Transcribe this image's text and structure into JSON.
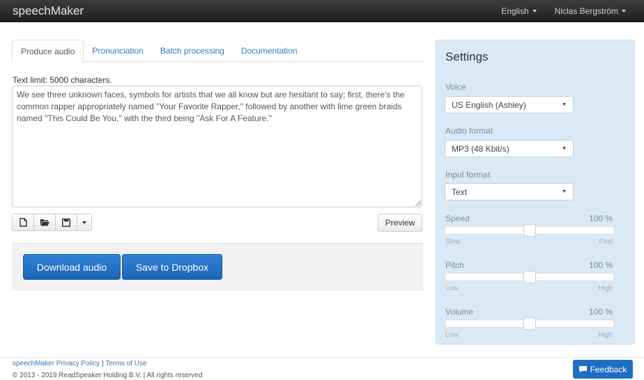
{
  "navbar": {
    "brand": "speechMaker",
    "language": "English",
    "user": "Niclas Bergström"
  },
  "tabs": [
    {
      "label": "Produce audio",
      "active": true
    },
    {
      "label": "Pronunciation",
      "active": false
    },
    {
      "label": "Batch processing",
      "active": false
    },
    {
      "label": "Documentation",
      "active": false
    }
  ],
  "editor": {
    "limit_text": "Text limit: 5000 characters.",
    "text": "We see three unknown faces, symbols for artists that we all know but are hesitant to say; first, there's the common rapper appropriately named \"Your Favorite Rapper,\" followed by another with lime green braids named \"This Could Be You,\" with the third being \"Ask For A Feature.\"",
    "preview_label": "Preview",
    "file_icons": [
      "new-file-icon",
      "open-folder-icon",
      "save-icon",
      "caret-down-icon"
    ]
  },
  "actions": {
    "download_label": "Download audio",
    "dropbox_label": "Save to Dropbox"
  },
  "settings": {
    "title": "Settings",
    "voice": {
      "label": "Voice",
      "value": "US English (Ashley)"
    },
    "audio_format": {
      "label": "Audio format",
      "value": "MP3 (48 Kbit/s)"
    },
    "input_format": {
      "label": "Input format",
      "value": "Text"
    },
    "speed": {
      "label": "Speed",
      "value_text": "100 %",
      "level": 0.5,
      "min": "Slow",
      "max": "Fast"
    },
    "pitch": {
      "label": "Pitch",
      "value_text": "100 %",
      "level": 0.5,
      "min": "Low",
      "max": "High"
    },
    "volume": {
      "label": "Volume",
      "value_text": "100 %",
      "level": 0.5,
      "min": "Low",
      "max": "High"
    }
  },
  "footer": {
    "privacy": "speechMaker Privacy Policy",
    "separator": "|",
    "terms": "Terms of Use",
    "copyright": "© 2013 - 2019 ReadSpeaker Holding B.V. | All rights reserved",
    "feedback_label": "Feedback"
  },
  "colors": {
    "accent": "#1e63b5",
    "settings_bg": "#d9eaf6",
    "navbar_bg": "#222222"
  }
}
